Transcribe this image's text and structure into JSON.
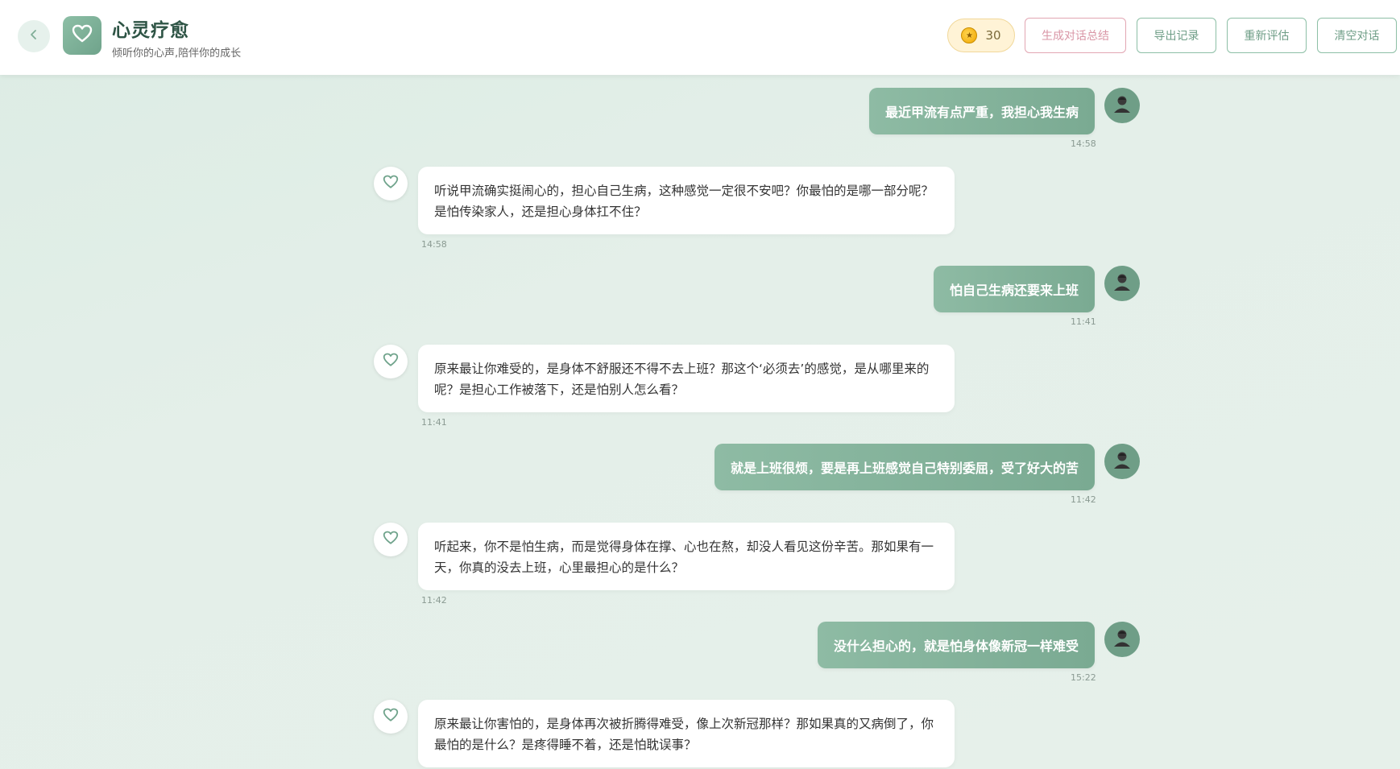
{
  "header": {
    "title": "心灵疗愈",
    "subtitle": "倾听你的心声,陪伴你的成长",
    "coins": "30",
    "buttons": {
      "summary": "生成对话总结",
      "export": "导出记录",
      "reassess": "重新评估",
      "clear": "清空对话"
    }
  },
  "messages": [
    {
      "role": "user",
      "text": "最近甲流有点严重，我担心我生病",
      "time": "14:58"
    },
    {
      "role": "ai",
      "text": "听说甲流确实挺闹心的，担心自己生病，这种感觉一定很不安吧？你最怕的是哪一部分呢？是怕传染家人，还是担心身体扛不住？",
      "time": "14:58"
    },
    {
      "role": "user",
      "text": "怕自己生病还要来上班",
      "time": "11:41"
    },
    {
      "role": "ai",
      "text": "原来最让你难受的，是身体不舒服还不得不去上班？那这个‘必须去’的感觉，是从哪里来的呢？是担心工作被落下，还是怕别人怎么看？",
      "time": "11:41"
    },
    {
      "role": "user",
      "text": "就是上班很烦，要是再上班感觉自己特别委屈，受了好大的苦",
      "time": "11:42"
    },
    {
      "role": "ai",
      "text": "听起来，你不是怕生病，而是觉得身体在撑、心也在熬，却没人看见这份辛苦。那如果有一天，你真的没去上班，心里最担心的是什么？",
      "time": "11:42"
    },
    {
      "role": "user",
      "text": "没什么担心的，就是怕身体像新冠一样难受",
      "time": "15:22"
    },
    {
      "role": "ai",
      "text": "原来最让你害怕的，是身体再次被折腾得难受，像上次新冠那样？那如果真的又病倒了，你最怕的是什么？是疼得睡不着，还是怕耽误事？",
      "time": ""
    }
  ],
  "colors": {
    "accent": "#7aaa92",
    "accent_light": "#8ebba4",
    "title": "#2e5445",
    "pink": "#d996a6",
    "background": "#dfece5"
  },
  "icons": {
    "back": "chevron-left-icon",
    "logo": "heart-icon",
    "coin": "coin-icon",
    "user_avatar": "person-avatar-icon",
    "ai_avatar": "heart-outline-icon"
  }
}
